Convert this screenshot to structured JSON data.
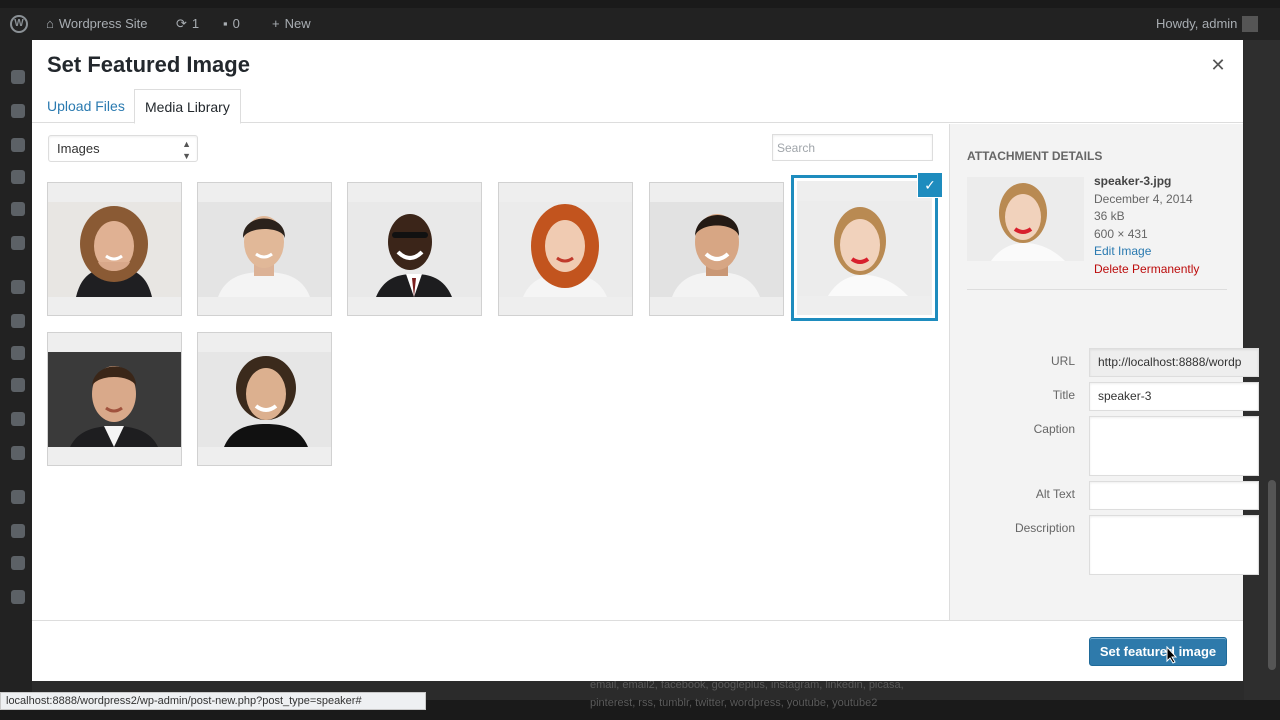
{
  "admin_bar": {
    "site_name": "Wordpress Site",
    "updates_count": "1",
    "comments_count": "0",
    "new_label": "New",
    "greeting": "Howdy, admin"
  },
  "modal": {
    "title": "Set Featured Image",
    "tabs": [
      {
        "label": "Upload Files",
        "active": false
      },
      {
        "label": "Media Library",
        "active": true
      }
    ],
    "filter": {
      "selected": "Images"
    },
    "search": {
      "placeholder": "Search",
      "value": ""
    },
    "thumbnails": [
      {
        "name": "speaker-woman-curly",
        "selected": false
      },
      {
        "name": "speaker-man-1",
        "selected": false
      },
      {
        "name": "speaker-man-glasses",
        "selected": false
      },
      {
        "name": "speaker-woman-red-hair",
        "selected": false
      },
      {
        "name": "speaker-man-smiling",
        "selected": false
      },
      {
        "name": "speaker-3",
        "selected": true
      },
      {
        "name": "speaker-man-suit",
        "selected": false
      },
      {
        "name": "speaker-man-turtleneck",
        "selected": false
      }
    ],
    "attachment_details": {
      "heading": "Attachment Details",
      "filename": "speaker-3.jpg",
      "date": "December 4, 2014",
      "filesize": "36 kB",
      "dimensions": "600 × 431",
      "edit_link": "Edit Image",
      "delete_link": "Delete Permanently",
      "fields": {
        "url_label": "URL",
        "url_value": "http://localhost:8888/wordp",
        "title_label": "Title",
        "title_value": "speaker-3",
        "caption_label": "Caption",
        "caption_value": "",
        "alt_label": "Alt Text",
        "alt_value": "",
        "description_label": "Description",
        "description_value": ""
      }
    },
    "footer": {
      "primary_button": "Set featured image"
    }
  },
  "background_text": {
    "line1": "email, email2, facebook, googleplus, instagram, linkedin, picasa,",
    "line2": "pinterest, rss, tumblr, twitter, wordpress, youtube, youtube2"
  },
  "status_url": "localhost:8888/wordpress2/wp-admin/post-new.php?post_type=speaker#",
  "colors": {
    "accent": "#1e8cbe",
    "primary_button": "#2e7aab",
    "link": "#2a7ab0",
    "delete": "#bc0b0b"
  }
}
